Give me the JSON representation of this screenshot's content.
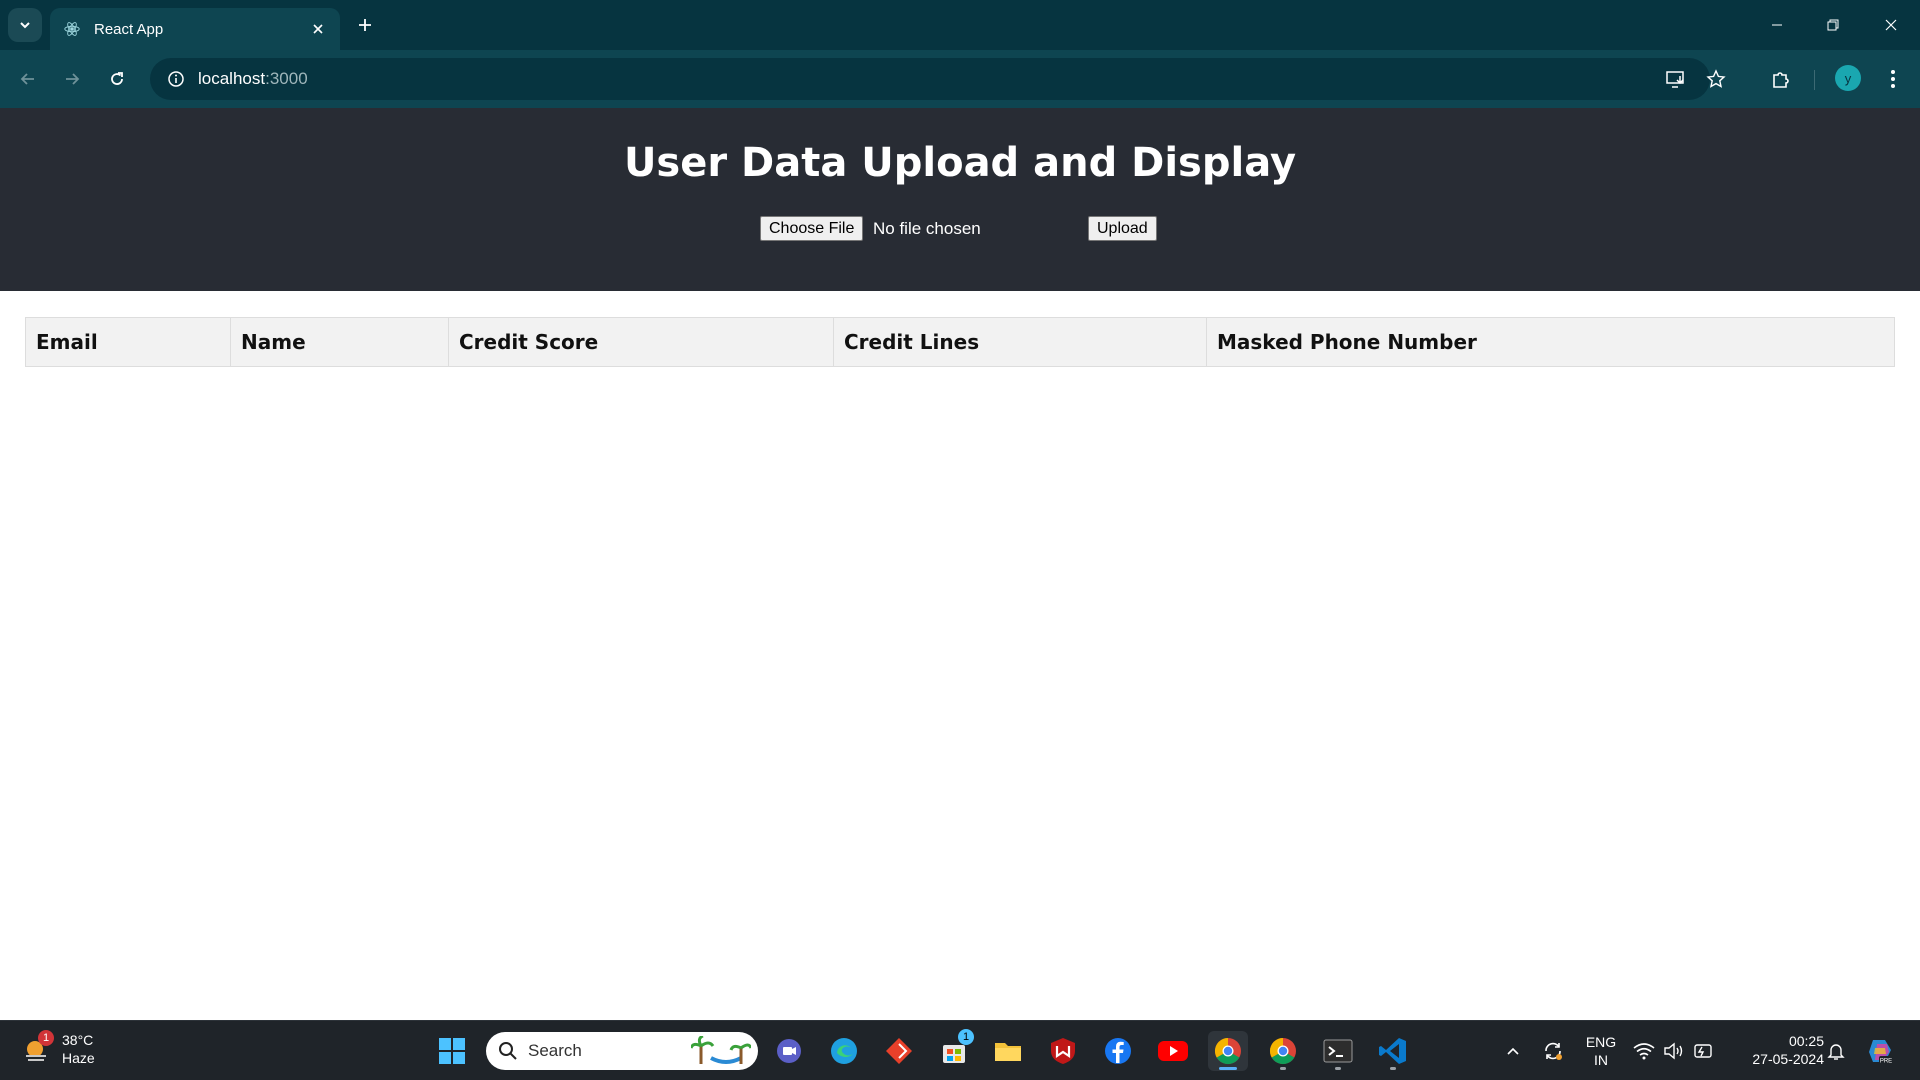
{
  "browser": {
    "tab_title": "React App",
    "url_host": "localhost",
    "url_port": ":3000",
    "profile_initial": "y"
  },
  "page": {
    "title": "User Data Upload and Display",
    "choose_file_label": "Choose File",
    "file_status": "No file chosen",
    "upload_label": "Upload",
    "table_headers": [
      "Email",
      "Name",
      "Credit Score",
      "Credit Lines",
      "Masked Phone Number"
    ]
  },
  "taskbar": {
    "weather_temp": "38°C",
    "weather_desc": "Haze",
    "weather_badge": "1",
    "search_placeholder": "Search",
    "store_badge": "1",
    "lang_top": "ENG",
    "lang_bottom": "IN",
    "time": "00:25",
    "date": "27-05-2024"
  },
  "colors": {
    "chrome_dark": "#063440",
    "chrome_toolbar": "#0e4551",
    "app_header_bg": "#282c34",
    "table_header_bg": "#f2f2f2",
    "taskbar_bg": "#1f2429"
  }
}
